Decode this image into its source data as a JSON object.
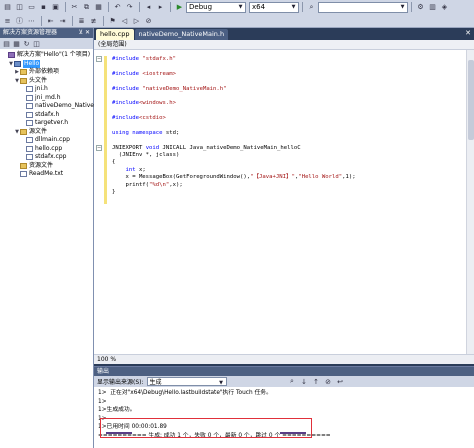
{
  "toolbar": {
    "config_value": "Debug",
    "platform_value": "x64"
  },
  "solution_explorer": {
    "title": "解决方案资源管理器",
    "pin": "⊻ ✕",
    "tree": [
      {
        "label": "解决方案\"Hello\"(1 个项目)",
        "indent": 0,
        "icon": "sln",
        "twisty": ""
      },
      {
        "label": "Hello",
        "indent": 1,
        "icon": "proj",
        "twisty": "▼",
        "selected": true
      },
      {
        "label": "外部依赖项",
        "indent": 2,
        "icon": "folder",
        "twisty": "▶"
      },
      {
        "label": "头文件",
        "indent": 2,
        "icon": "folder",
        "twisty": "▼"
      },
      {
        "label": "jni.h",
        "indent": 3,
        "icon": "file",
        "twisty": ""
      },
      {
        "label": "jni_md.h",
        "indent": 3,
        "icon": "file",
        "twisty": ""
      },
      {
        "label": "nativeDemo_NativeMain.h",
        "indent": 3,
        "icon": "file",
        "twisty": ""
      },
      {
        "label": "stdafx.h",
        "indent": 3,
        "icon": "file",
        "twisty": ""
      },
      {
        "label": "targetver.h",
        "indent": 3,
        "icon": "file",
        "twisty": ""
      },
      {
        "label": "源文件",
        "indent": 2,
        "icon": "folder",
        "twisty": "▼"
      },
      {
        "label": "dllmain.cpp",
        "indent": 3,
        "icon": "file",
        "twisty": ""
      },
      {
        "label": "hello.cpp",
        "indent": 3,
        "icon": "file",
        "twisty": ""
      },
      {
        "label": "stdafx.cpp",
        "indent": 3,
        "icon": "file",
        "twisty": ""
      },
      {
        "label": "资源文件",
        "indent": 2,
        "icon": "folder",
        "twisty": ""
      },
      {
        "label": "ReadMe.txt",
        "indent": 2,
        "icon": "file",
        "twisty": ""
      }
    ]
  },
  "editor": {
    "tabs": [
      {
        "label": "hello.cpp",
        "active": true
      },
      {
        "label": "nativeDemo_NativeMain.h",
        "active": false
      }
    ],
    "close_glyph": "✕",
    "scope": "(全局范围)",
    "zoom": "100 %"
  },
  "output": {
    "title": "输出",
    "source_label": "显示输出来源(S):",
    "source_value": "生成",
    "lines": [
      "1>  正在对\"x64\\Debug\\Hello.lastbuildstate\"执行 Touch 任务。",
      "1>",
      "1>生成成功。",
      "1>",
      "1>已用时间 00:00:01.89",
      "========== 生成: 成功 1 个，失败 0 个，最新 0 个，跳过 0 个 =========="
    ]
  }
}
